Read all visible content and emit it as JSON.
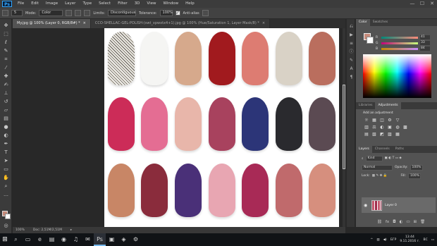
{
  "app": {
    "logo": "Ps"
  },
  "menu": [
    "File",
    "Edit",
    "Image",
    "Layer",
    "Type",
    "Select",
    "Filter",
    "3D",
    "View",
    "Window",
    "Help"
  ],
  "window_controls": [
    "—",
    "☐",
    "✕"
  ],
  "options": {
    "brush_size": "5",
    "mode_label": "Mode:",
    "mode_value": "Color",
    "limits_label": "Limits:",
    "limits_value": "Discontiguous",
    "tolerance_label": "Tolerance:",
    "tolerance_value": "100%",
    "antialias_label": "Anti-alias"
  },
  "tabs": [
    {
      "label": "My.jpg @ 100% (Layer 0, RGB/8#) *",
      "active": true
    },
    {
      "label": "CCO-SHELLAC-GEL-POLISH-(swt_xpwxtx4+1).jpg @ 100% (Hue/Saturation 1, Layer Mask/8) *",
      "active": false
    }
  ],
  "status": {
    "zoom": "100%",
    "doc": "Doc: 2,51M/2,51M"
  },
  "color_panel": {
    "tabs": [
      "Color",
      "Swatches"
    ],
    "sliders": [
      {
        "label": "R",
        "value": "41"
      },
      {
        "label": "G",
        "value": "33"
      },
      {
        "label": "B",
        "value": "84"
      }
    ],
    "foreground": "#c58a7a"
  },
  "adjustments": {
    "tabs": [
      "Libraries",
      "Adjustments"
    ],
    "title": "Add an adjustment",
    "icons": [
      "☼",
      "▦",
      "◫",
      "⚙",
      "▽",
      "",
      "",
      "▥",
      "⚖",
      "◐",
      "▣",
      "◍",
      "▩",
      "",
      "▤",
      "▧",
      "◩",
      "▨",
      "▦",
      "",
      ""
    ]
  },
  "layers": {
    "tabs": [
      "Layers",
      "Channels",
      "Paths"
    ],
    "kind": "Kind",
    "blend": "Normal",
    "opacity_label": "Opacity:",
    "opacity": "100%",
    "lock_label": "Lock:",
    "fill_label": "Fill:",
    "fill": "100%",
    "items": [
      {
        "name": "Layer 0",
        "visible": true
      }
    ]
  },
  "nails": [
    "glitter",
    "#f5f5f3",
    "#d6a98c",
    "#a11a1e",
    "#dd7c72",
    "#d9d2c6",
    "#ba6e5e",
    "#cc2c58",
    "#e46d93",
    "#e8b6aa",
    "#a8425e",
    "#2c3578",
    "#2a2a2e",
    "#5b4a52",
    "#c88666",
    "#8a2c3c",
    "#4a3078",
    "#e8a6b2",
    "#a82a56",
    "#c06a6c",
    "#d68f7e"
  ],
  "taskbar": {
    "icons": [
      "⌕",
      "▭",
      "e",
      "▤",
      "◉",
      "♫",
      "✉",
      "Ps",
      "▣",
      "◈",
      "⚙"
    ],
    "active_index": 7,
    "lang": "БГР",
    "time": "13:44",
    "date": "9.11.2016 г.",
    "day": "ВС"
  }
}
